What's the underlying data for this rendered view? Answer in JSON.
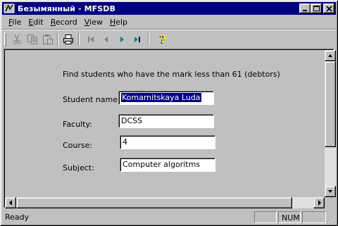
{
  "window": {
    "title": "Безымянный - MFSDB",
    "icon": "app-icon",
    "caption_buttons": [
      "minimize-icon",
      "maximize-icon",
      "close-icon"
    ]
  },
  "menu": {
    "items": [
      {
        "label": "File"
      },
      {
        "label": "Edit"
      },
      {
        "label": "Record"
      },
      {
        "label": "View"
      },
      {
        "label": "Help"
      }
    ]
  },
  "toolbar": {
    "buttons": [
      {
        "icon": "cut-icon",
        "enabled": false
      },
      {
        "icon": "copy-icon",
        "enabled": false
      },
      {
        "icon": "paste-icon",
        "enabled": false
      },
      {
        "icon": "print-icon",
        "enabled": true
      },
      {
        "icon": "first-record-icon",
        "enabled": false
      },
      {
        "icon": "previous-record-icon",
        "enabled": false
      },
      {
        "icon": "next-record-icon",
        "enabled": true
      },
      {
        "icon": "last-record-icon",
        "enabled": true
      },
      {
        "icon": "help-icon",
        "enabled": true
      }
    ]
  },
  "form": {
    "heading": "Find students who have the mark less than 61 (debtors)",
    "fields": {
      "student_name": {
        "label": "Student name:",
        "value": "Komarnitskaya Luda"
      },
      "faculty": {
        "label": "Faculty:",
        "value": "DCSS"
      },
      "course": {
        "label": "Course:",
        "value": "4"
      },
      "subject": {
        "label": "Subject:",
        "value": "Computer algoritms"
      }
    }
  },
  "statusbar": {
    "text": "Ready",
    "indicators": [
      "",
      "NUM",
      ""
    ]
  },
  "colors": {
    "titlebar": "#000080",
    "face": "#c0c0c0",
    "toolbar_green": "#008080"
  }
}
